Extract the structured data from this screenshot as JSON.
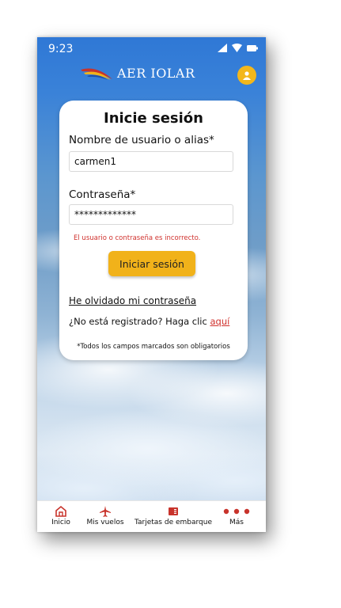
{
  "status_bar": {
    "time": "9:23"
  },
  "header": {
    "brand": "AER IOLAR"
  },
  "login": {
    "title": "Inicie sesión",
    "username_label": "Nombre de usuario o alias*",
    "username_value": "carmen1",
    "password_label": "Contraseña*",
    "password_value": "*************",
    "error": "El usuario o contraseña es incorrecto.",
    "submit_label": "Iniciar sesión",
    "forgot_link": "He olvidado mi contraseña",
    "register_text": "¿No está registrado? Haga clic ",
    "register_link": "aquí",
    "required_note": "*Todos los campos marcados son obligatorios"
  },
  "tabs": [
    {
      "label": "Inicio",
      "icon": "home-icon"
    },
    {
      "label": "Mis vuelos",
      "icon": "airplane-icon"
    },
    {
      "label": "Tarjetas de embarque",
      "icon": "boarding-pass-icon"
    },
    {
      "label": "Más",
      "icon": "more-dots-icon"
    }
  ],
  "colors": {
    "accent": "#f1b21a",
    "error": "#d0312d",
    "brand_red": "#c8332b"
  }
}
